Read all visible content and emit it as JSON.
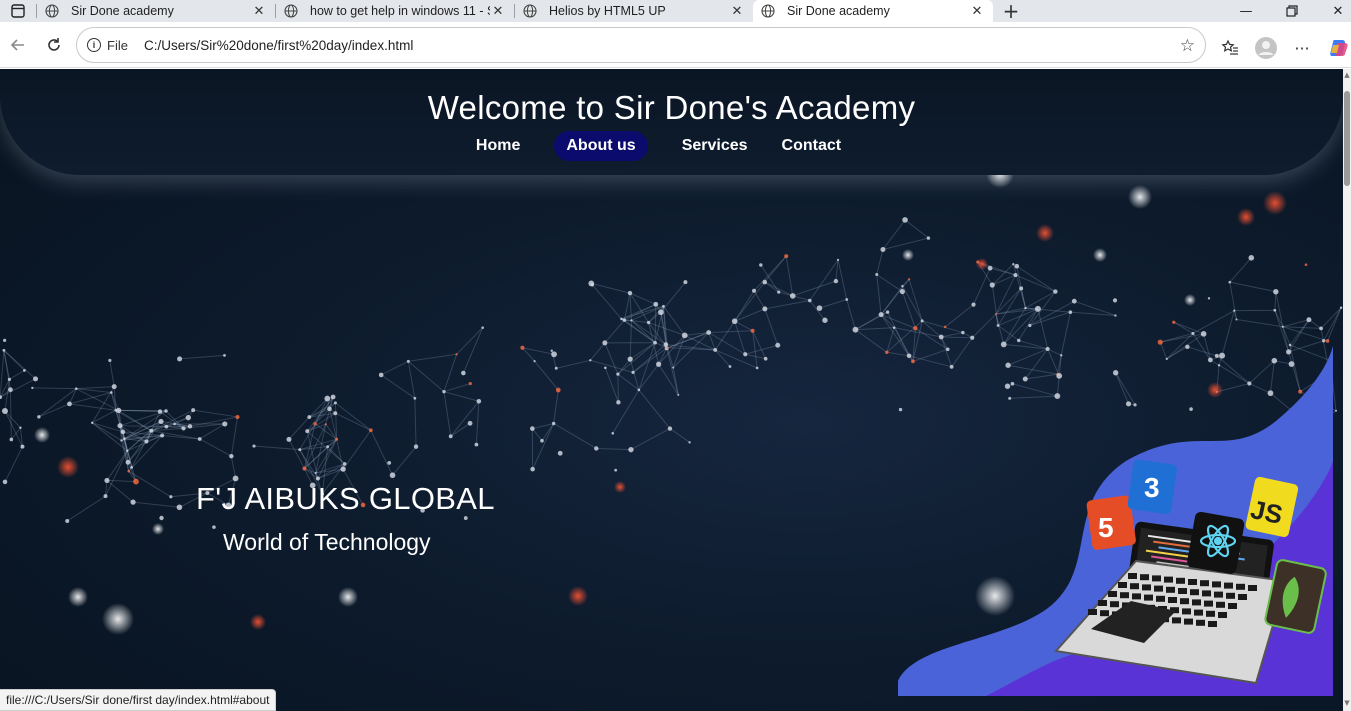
{
  "browser": {
    "tabs": [
      {
        "title": "Sir Done academy",
        "active": false
      },
      {
        "title": "how to get help in windows 11 - S",
        "active": false
      },
      {
        "title": "Helios by HTML5 UP",
        "active": false
      },
      {
        "title": "Sir Done academy",
        "active": true
      }
    ],
    "new_tab_icon": "plus-icon",
    "address": {
      "scheme_label": "File",
      "url": "C:/Users/Sir%20done/first%20day/index.html"
    },
    "status_url": "file:///C:/Users/Sir done/first day/index.html#about"
  },
  "site": {
    "title": "Welcome to Sir Done's Academy",
    "nav": {
      "home": "Home",
      "about": "About us",
      "services": "Services",
      "contact": "Contact"
    },
    "hero": {
      "title": "F'J AIBUKS GLOBAL",
      "subtitle": "World of Technology"
    },
    "illustration": {
      "badges": [
        "5",
        "3",
        "JS"
      ]
    }
  },
  "colors": {
    "nav_active_bg": "#0b0b6e",
    "page_bg": "#0d1b2d",
    "blob_purple": "#5a33d6",
    "blob_blue": "#4b63d8"
  }
}
